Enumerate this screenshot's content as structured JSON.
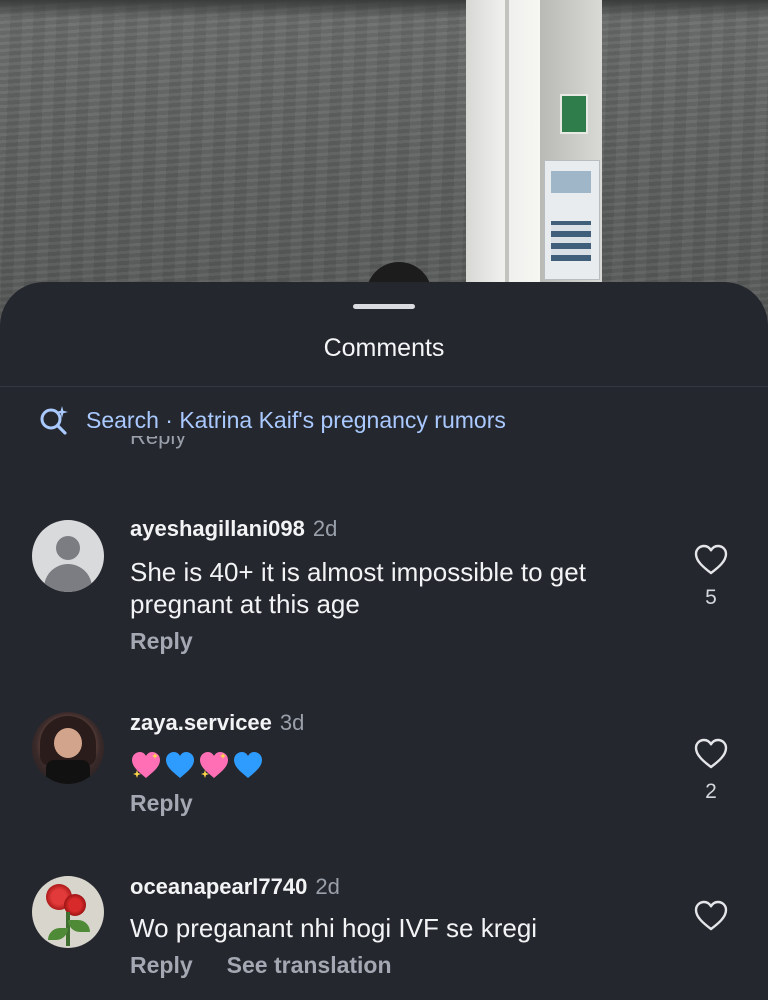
{
  "sheet": {
    "title": "Comments",
    "search": {
      "prefix": "Search · ",
      "query": "Katrina Kaif's pregnancy rumors"
    },
    "previous_reply_label": "Reply"
  },
  "comments": [
    {
      "username": "ayeshagillani098",
      "time": "2d",
      "text": "She is 40+ it is almost impossible to get pregnant at this age",
      "reply_label": "Reply",
      "likes": "5",
      "avatar": "default-avatar"
    },
    {
      "username": "zaya.servicee",
      "time": "3d",
      "emojis": [
        "sparkling-heart",
        "blue-heart",
        "sparkling-heart",
        "blue-heart"
      ],
      "reply_label": "Reply",
      "likes": "2",
      "avatar": "photo"
    },
    {
      "username": "oceanapearl7740",
      "time": "2d",
      "text": "Wo preganant nhi hogi IVF se kregi",
      "reply_label": "Reply",
      "see_translation_label": "See translation",
      "likes": "",
      "avatar": "photo"
    }
  ],
  "colors": {
    "sheet_background": "#25272e",
    "search_text": "#a9c9ff",
    "primary_text": "#f2f3f5",
    "secondary_text": "#a3a8b2",
    "sparkling_heart": "#ff6fb5",
    "blue_heart": "#2e9bff"
  }
}
